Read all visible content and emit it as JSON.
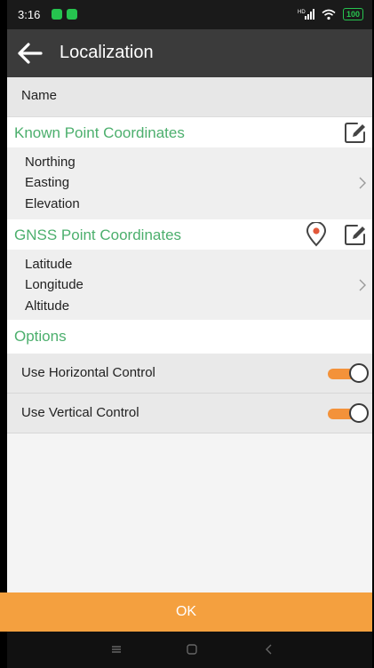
{
  "status_bar": {
    "time": "3:16",
    "battery": "100",
    "signal_label": "HD"
  },
  "app_bar": {
    "title": "Localization"
  },
  "name_row": {
    "label": "Name"
  },
  "known_point": {
    "title": "Known Point Coordinates",
    "lines": [
      "Northing",
      "Easting",
      "Elevation"
    ]
  },
  "gnss_point": {
    "title": "GNSS Point Coordinates",
    "lines": [
      "Latitude",
      "Longitude",
      "Altitude"
    ]
  },
  "options": {
    "title": "Options",
    "items": [
      {
        "label": "Use Horizontal Control",
        "on": true
      },
      {
        "label": "Use Vertical Control",
        "on": true
      }
    ]
  },
  "ok_button": {
    "label": "OK"
  },
  "colors": {
    "accent": "#f3923a",
    "section_green": "#4caf6d",
    "appbar": "#3b3b3b"
  }
}
